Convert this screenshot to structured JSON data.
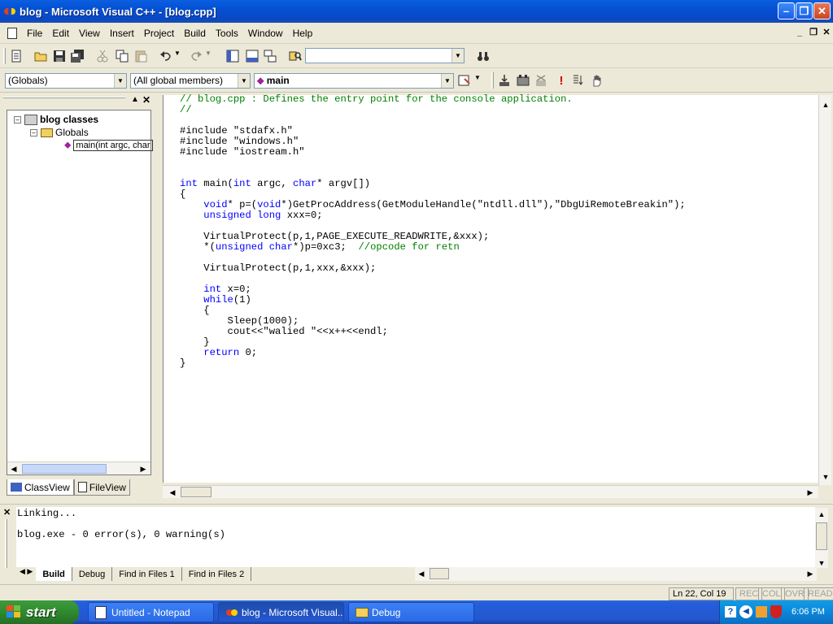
{
  "window": {
    "title": "blog - Microsoft Visual C++ - [blog.cpp]"
  },
  "menu": [
    "File",
    "Edit",
    "View",
    "Insert",
    "Project",
    "Build",
    "Tools",
    "Window",
    "Help"
  ],
  "toolbar": {
    "find_combo_value": "",
    "scope_combo": "(Globals)",
    "members_combo": "(All global members)",
    "function_combo": "main"
  },
  "workspace": {
    "root": "blog classes",
    "folder": "Globals",
    "item": "main(int argc, char",
    "tabs": [
      "ClassView",
      "FileView"
    ]
  },
  "editor": {
    "lines": [
      "// blog.cpp : Defines the entry point for the console application.",
      "//",
      "",
      "#include \"stdafx.h\"",
      "#include \"windows.h\"",
      "#include \"iostream.h\"",
      "",
      "",
      "int main(int argc, char* argv[])",
      "{",
      "    void* p=(void*)GetProcAddress(GetModuleHandle(\"ntdll.dll\"),\"DbgUiRemoteBreakin\");",
      "    unsigned long xxx=0;",
      "",
      "    VirtualProtect(p,1,PAGE_EXECUTE_READWRITE,&xxx);",
      "    *(unsigned char*)p=0xc3;  //opcode for retn",
      "",
      "    VirtualProtect(p,1,xxx,&xxx);",
      "",
      "    int x=0;",
      "    while(1)",
      "    {",
      "        Sleep(1000);",
      "        cout<<\"walied \"<<x++<<endl;",
      "    }",
      "    return 0;",
      "}"
    ]
  },
  "output": {
    "lines": [
      "Linking...",
      "",
      "blog.exe - 0 error(s), 0 warning(s)"
    ],
    "tabs": [
      "Build",
      "Debug",
      "Find in Files 1",
      "Find in Files 2"
    ]
  },
  "status": {
    "position": "Ln 22, Col 19",
    "indicators": [
      "REC",
      "COL",
      "OVR",
      "READ"
    ]
  },
  "taskbar": {
    "start": "start",
    "buttons": [
      "Untitled - Notepad",
      "blog - Microsoft Visual...",
      "Debug"
    ],
    "clock": "6:06 PM"
  }
}
